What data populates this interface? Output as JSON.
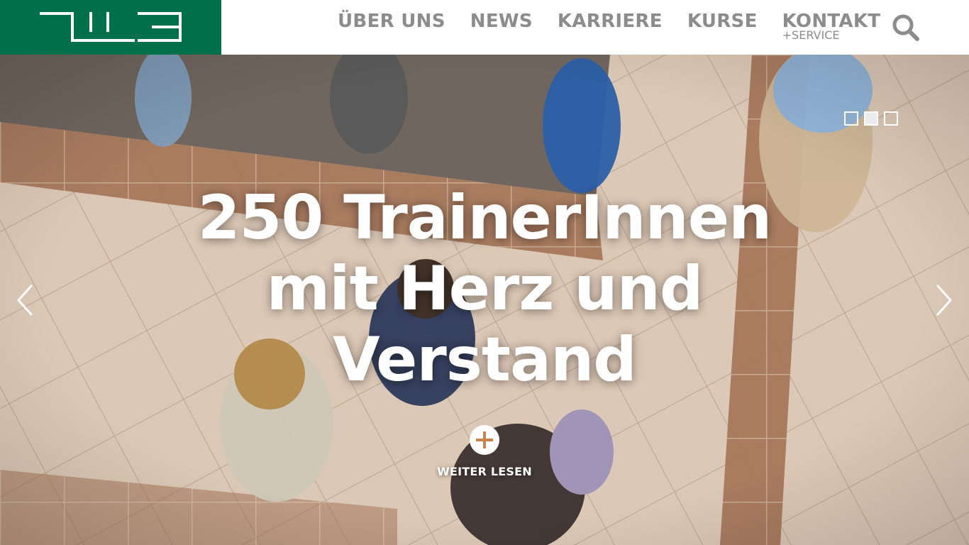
{
  "header": {
    "logo_label": "TLI3 logo",
    "brand_color": "#00704a",
    "nav": [
      {
        "label": "ÜBER UNS",
        "sub": ""
      },
      {
        "label": "NEWS",
        "sub": ""
      },
      {
        "label": "KARRIERE",
        "sub": ""
      },
      {
        "label": "KURSE",
        "sub": ""
      },
      {
        "label": "KONTAKT",
        "sub": "+SERVICE"
      }
    ],
    "search_icon": "search-icon",
    "nav_text_color": "#8c8c8c"
  },
  "hero": {
    "headline_lines": [
      "250 TrainerInnen",
      "mit Herz und",
      "Verstand"
    ],
    "read_more_label": "WEITER LESEN",
    "read_more_icon": "plus-icon",
    "accent_color": "#c9834e",
    "prev_icon": "chevron-left-icon",
    "next_icon": "chevron-right-icon",
    "slides_total": 3,
    "slide_active": 2
  }
}
